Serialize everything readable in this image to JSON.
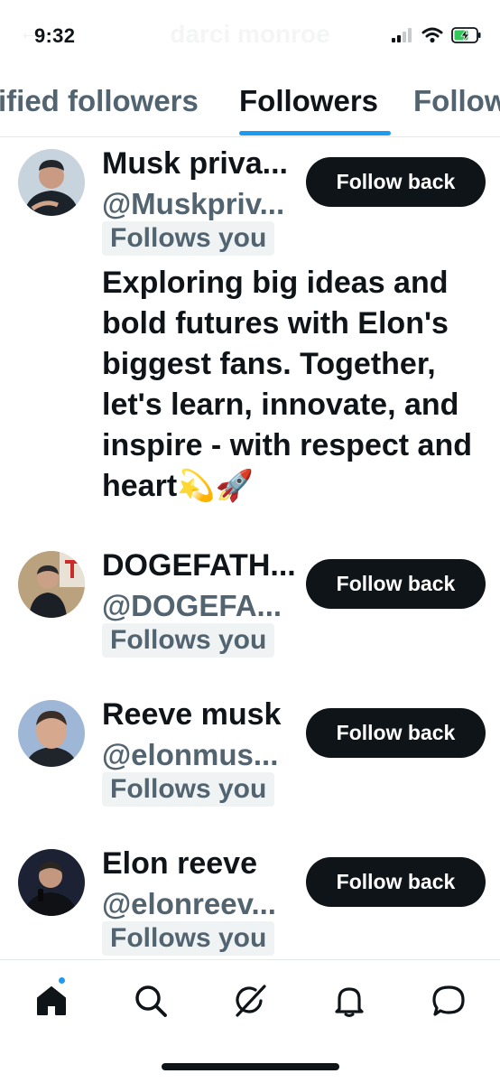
{
  "status_bar": {
    "time": "9:32",
    "ghost_title": "darci monroe",
    "icons": [
      "cellular-signal-icon",
      "wifi-icon",
      "battery-charging-icon"
    ]
  },
  "tabs": [
    {
      "label": "ified followers",
      "active": false
    },
    {
      "label": "Followers",
      "active": true
    },
    {
      "label": "Follow",
      "active": false
    }
  ],
  "followers": [
    {
      "name": "Musk priva...",
      "handle": "@Muskpriv...",
      "follows_you": "Follows you",
      "bio": "Exploring big ideas and bold futures with Elon's biggest fans. Together, let's learn, innovate, and inspire - with respect and heart💫🚀",
      "button": "Follow back"
    },
    {
      "name": "DOGEFATH...",
      "handle": "@DOGEFA...",
      "follows_you": "Follows you",
      "button": "Follow back"
    },
    {
      "name": "Reeve musk",
      "handle": "@elonmus...",
      "follows_you": "Follows you",
      "button": "Follow back"
    },
    {
      "name": "Elon reeve",
      "handle": "@elonreev...",
      "follows_you": "Follows you",
      "button": "Follow back"
    }
  ],
  "bottom_nav": {
    "items": [
      "home-icon",
      "search-icon",
      "grok-icon",
      "notifications-icon",
      "messages-icon"
    ],
    "home_has_notification_dot": true
  },
  "colors": {
    "accent": "#1d9bf0",
    "text_primary": "#0f1419",
    "text_secondary": "#536471",
    "button_bg": "#0f1419",
    "badge_bg": "#eff3f4"
  }
}
